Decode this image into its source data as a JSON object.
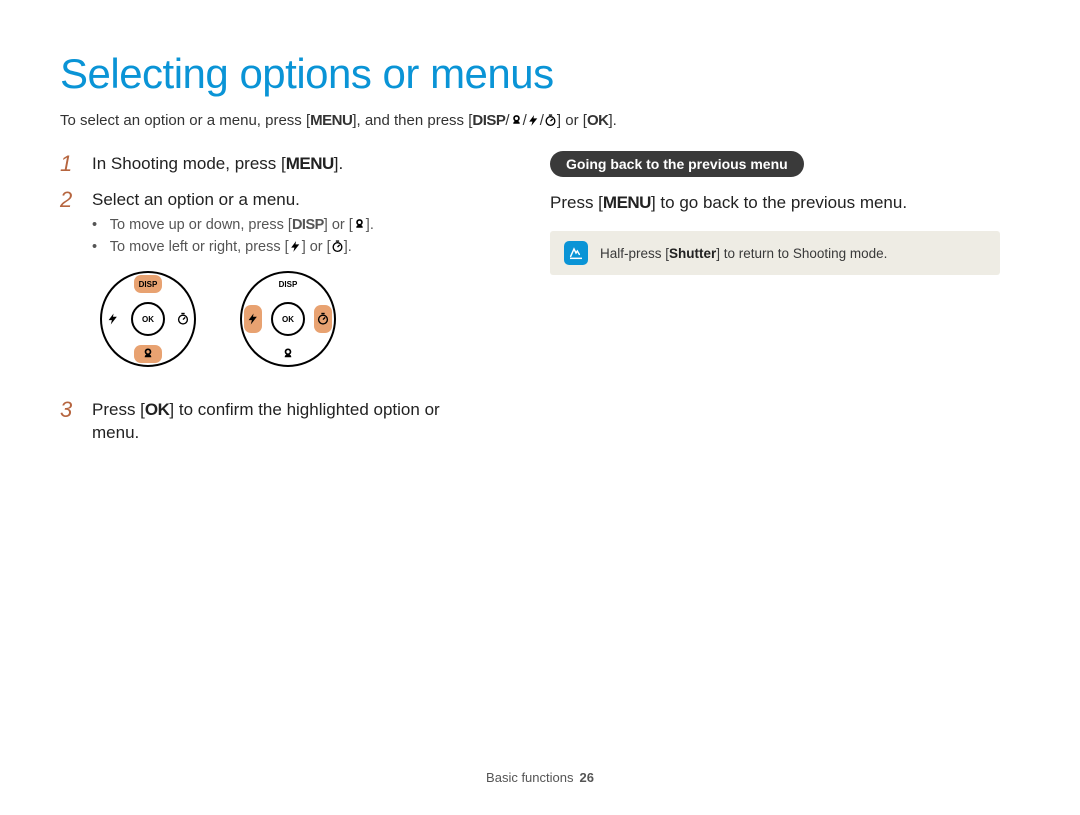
{
  "title": "Selecting options or menus",
  "intro": {
    "part1": "To select an option or a menu, press [",
    "menu": "MENU",
    "part2": "], and then press [",
    "disp": "DISP",
    "part3": "] or [",
    "ok": "OK",
    "part4": "]."
  },
  "steps": [
    {
      "num": "1",
      "text_a": "In Shooting mode, press [",
      "label": "MENU",
      "text_b": "]."
    },
    {
      "num": "2",
      "text_a": "Select an option or a menu.",
      "bullets": {
        "b1a": "To move up or down, press [",
        "b1_disp": "DISP",
        "b1b": "] or [",
        "b1c": "].",
        "b2a": "To move left or right, press [",
        "b2b": "] or [",
        "b2c": "]."
      }
    },
    {
      "num": "3",
      "text_a": "Press [",
      "label": "OK",
      "text_b": "] to confirm the highlighted option or menu."
    }
  ],
  "dial_labels": {
    "disp": "DISP",
    "ok": "OK"
  },
  "right": {
    "heading": "Going back to the previous menu",
    "body_a": "Press [",
    "body_label": "MENU",
    "body_b": "] to go back to the previous menu.",
    "note_a": "Half-press [",
    "note_bold": "Shutter",
    "note_b": "] to return to Shooting mode."
  },
  "footer": {
    "section": "Basic functions",
    "page": "26"
  }
}
